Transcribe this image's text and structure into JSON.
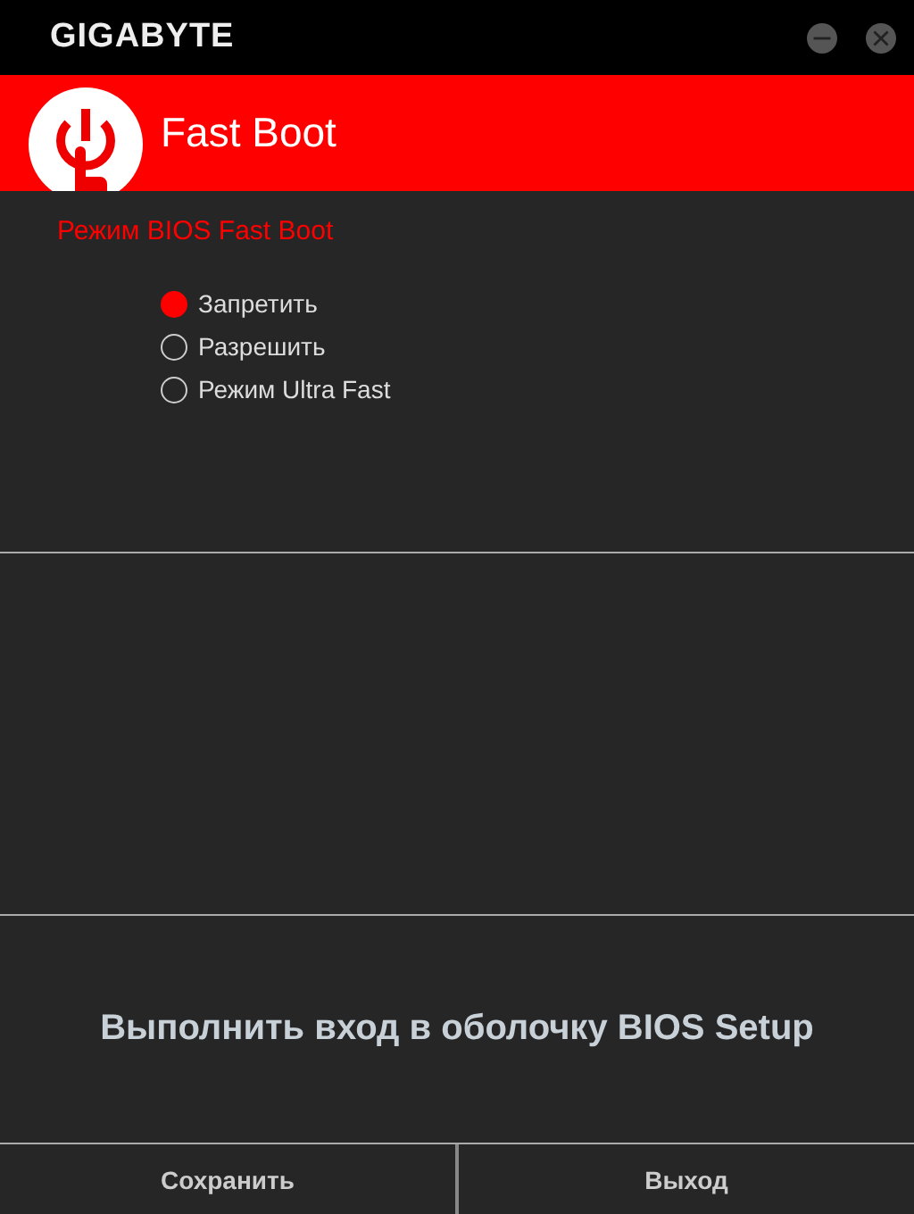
{
  "window": {
    "logo": "GIGABYTE"
  },
  "header": {
    "title": "Fast Boot"
  },
  "section": {
    "title": "Режим BIOS Fast Boot",
    "options": [
      {
        "label": "Запретить",
        "selected": true
      },
      {
        "label": "Разрешить",
        "selected": false
      },
      {
        "label": "Режим Ultra Fast",
        "selected": false
      }
    ]
  },
  "action": {
    "label": "Выполнить вход в оболочку BIOS Setup"
  },
  "buttons": [
    "Сохранить",
    "Выход"
  ]
}
